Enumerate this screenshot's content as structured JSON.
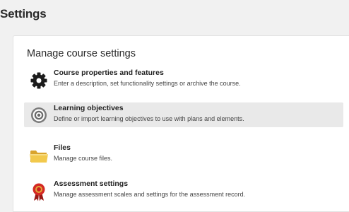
{
  "page": {
    "title": "Settings"
  },
  "card": {
    "heading": "Manage course settings",
    "items": [
      {
        "title": "Course properties and features",
        "description": "Enter a description, set functionality settings or archive the course.",
        "icon": "gear-icon",
        "icon_color": "#1c1c1c"
      },
      {
        "title": "Learning objectives",
        "description": "Define or import learning objectives to use with plans and elements.",
        "icon": "target-icon",
        "icon_color": "#6a6a6a"
      },
      {
        "title": "Files",
        "description": "Manage course files.",
        "icon": "folder-icon",
        "icon_color": "#f0c24a"
      },
      {
        "title": "Assessment settings",
        "description": "Manage assessment scales and settings for the assessment record.",
        "icon": "award-ribbon-icon",
        "icon_color": "#c9211d"
      }
    ]
  },
  "colors": {
    "background": "#f1f1f1",
    "card": "#ffffff",
    "highlight": "#e9e9e9"
  }
}
